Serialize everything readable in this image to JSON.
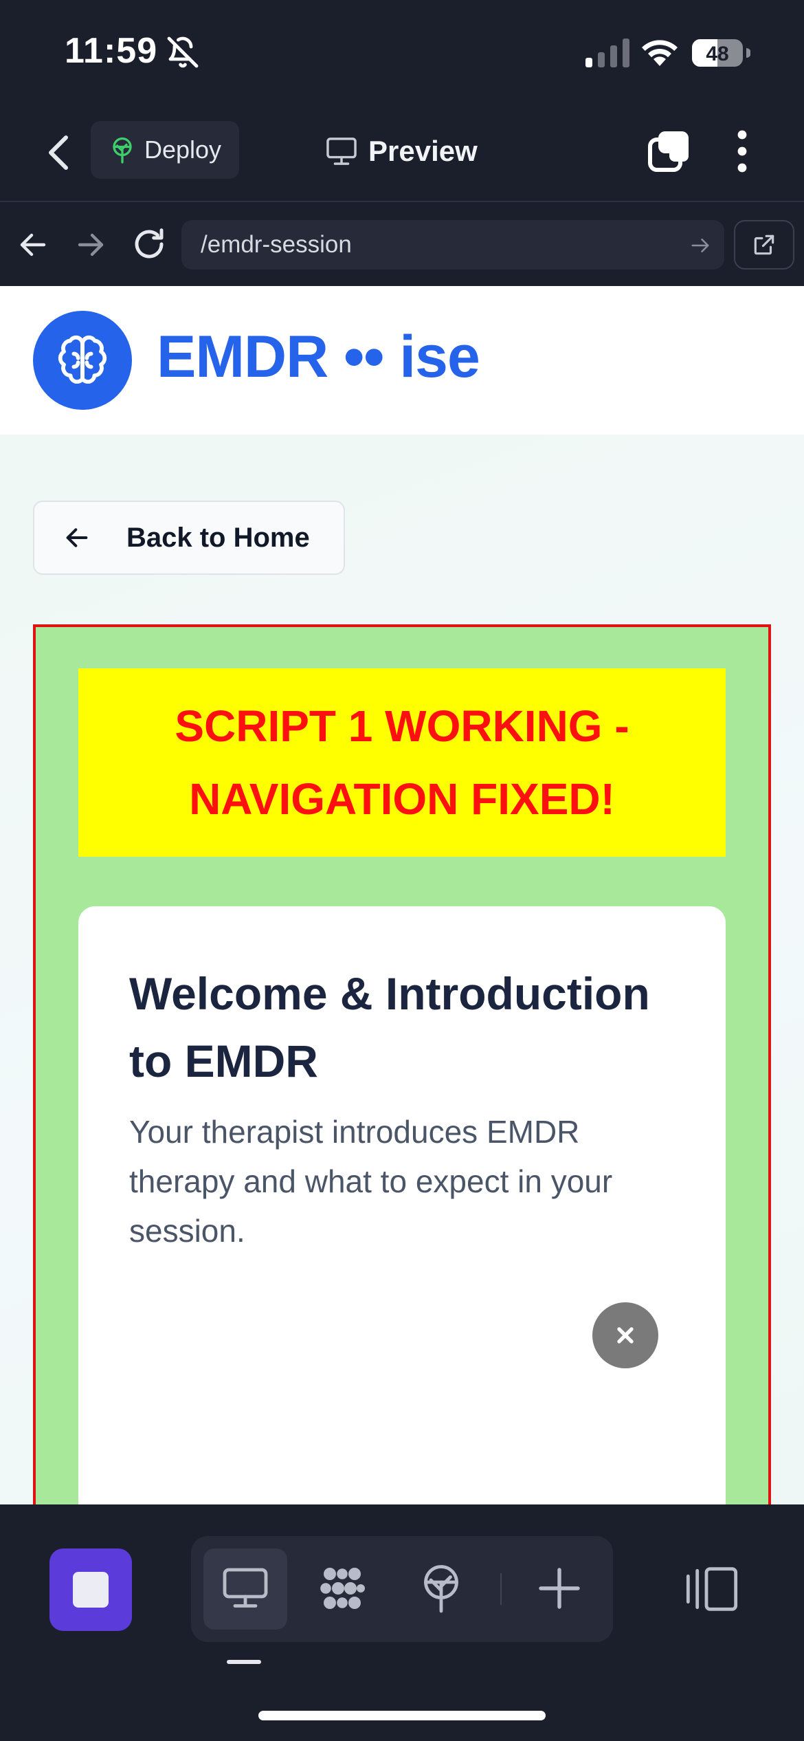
{
  "status_bar": {
    "time": "11:59",
    "battery": "48"
  },
  "app_header": {
    "deploy_label": "Deploy",
    "preview_label": "Preview"
  },
  "browser": {
    "url": "/emdr-session"
  },
  "site": {
    "title": "EMDR •• ise",
    "back_label": "Back to Home",
    "banner_text": "SCRIPT 1 WORKING - NAVIGATION FIXED!",
    "card": {
      "title": "Welcome & Introduction to EMDR",
      "description": "Your therapist introduces EMDR therapy and what to expect in your session."
    }
  },
  "icons": {
    "status": [
      "bell-slash-icon",
      "cellular-signal-icon",
      "wifi-icon",
      "battery-icon"
    ],
    "header": [
      "back-chevron-icon",
      "deploy-tree-icon",
      "monitor-icon",
      "tabs-icon",
      "more-vertical-icon"
    ],
    "browser": [
      "arrow-left-icon",
      "arrow-right-icon",
      "reload-icon",
      "go-arrow-icon",
      "open-external-icon"
    ],
    "toolbar": [
      "stop-icon",
      "monitor-icon",
      "dots-grid-icon",
      "deploy-tree-icon",
      "plus-icon",
      "layout-panel-icon"
    ]
  },
  "colors": {
    "chrome_bg": "#1b1e2b",
    "brand_blue": "#2563eb",
    "banner_yellow": "#ffff00",
    "banner_text_red": "#ff1010",
    "debug_green": "#a8e89a",
    "debug_border": "#e11212",
    "stop_purple": "#5b3bd9"
  }
}
